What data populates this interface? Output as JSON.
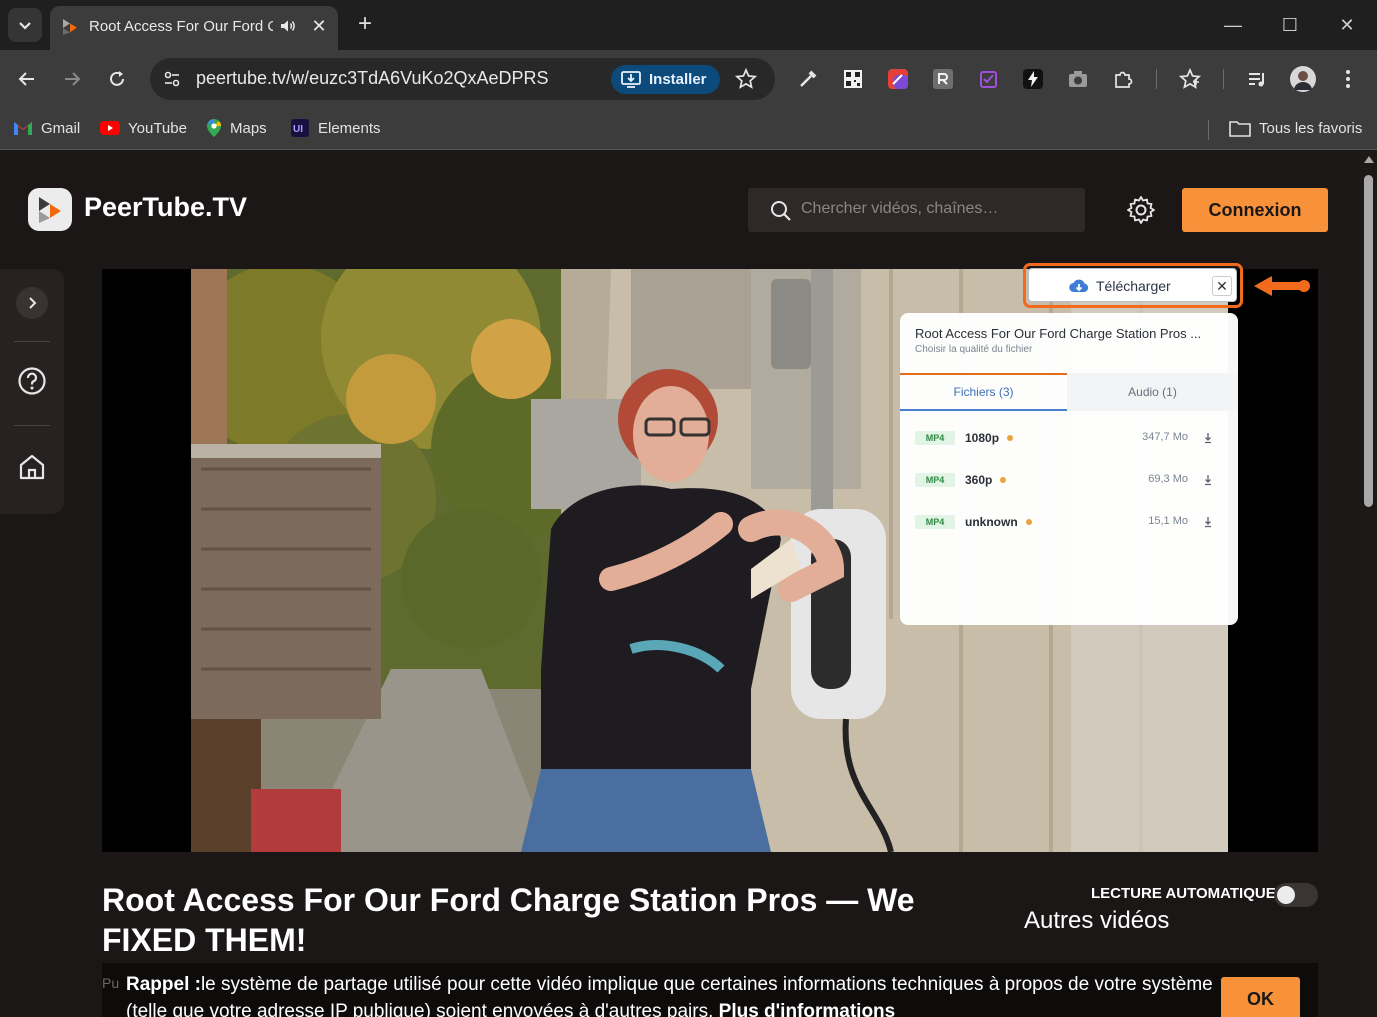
{
  "browser": {
    "tab_title": "Root Access For Our Ford Charge Station Pros — We FIXED THEM!",
    "url": "peertube.tv/w/euzc3TdA6VuKo2QxAeDPRS",
    "install_label": "Installer",
    "bookmarks": [
      {
        "label": "Gmail",
        "icon": "gmail-icon"
      },
      {
        "label": "YouTube",
        "icon": "youtube-icon"
      },
      {
        "label": "Maps",
        "icon": "maps-icon"
      },
      {
        "label": "Elements",
        "icon": "elements-icon"
      }
    ],
    "all_bookmarks_label": "Tous les favoris"
  },
  "header": {
    "brand": "PeerTube.TV",
    "search_placeholder": "Chercher vidéos, chaînes…",
    "login_label": "Connexion"
  },
  "sidebar": {
    "items": [
      {
        "icon": "chevron-right-icon"
      },
      {
        "icon": "help-icon"
      },
      {
        "icon": "home-icon"
      }
    ]
  },
  "downloader": {
    "button_label": "Télécharger",
    "panel_title": "Root Access For Our Ford Charge Station Pros ...",
    "panel_subtitle": "Choisir la qualité du fichier",
    "tabs": [
      {
        "label": "Fichiers (3)",
        "active": true
      },
      {
        "label": "Audio (1)",
        "active": false
      }
    ],
    "files": [
      {
        "format": "MP4",
        "quality": "1080p",
        "size": "347,7 Mo"
      },
      {
        "format": "MP4",
        "quality": "360p",
        "size": "69,3 Mo"
      },
      {
        "format": "MP4",
        "quality": "unknown",
        "size": "15,1 Mo"
      }
    ]
  },
  "video": {
    "title": "Root Access For Our Ford Charge Station Pros — We FIXED THEM!",
    "autoplay_label": "LECTURE AUTOMATIQUE",
    "autoplay_on": false,
    "other_videos_label": "Autres vidéos"
  },
  "notice": {
    "under_text": "Pu",
    "bold": "Rappel :",
    "text": "le système de partage utilisé pour cette vidéo implique que certaines informations techniques à propos de votre système (telle que votre adresse IP publique) soient envoyées à d'autres pairs.",
    "link": "Plus d'informations",
    "ok_label": "OK"
  },
  "colors": {
    "accent": "#f7923a",
    "highlight": "#f26b1d",
    "page_bg": "#1b1717"
  }
}
